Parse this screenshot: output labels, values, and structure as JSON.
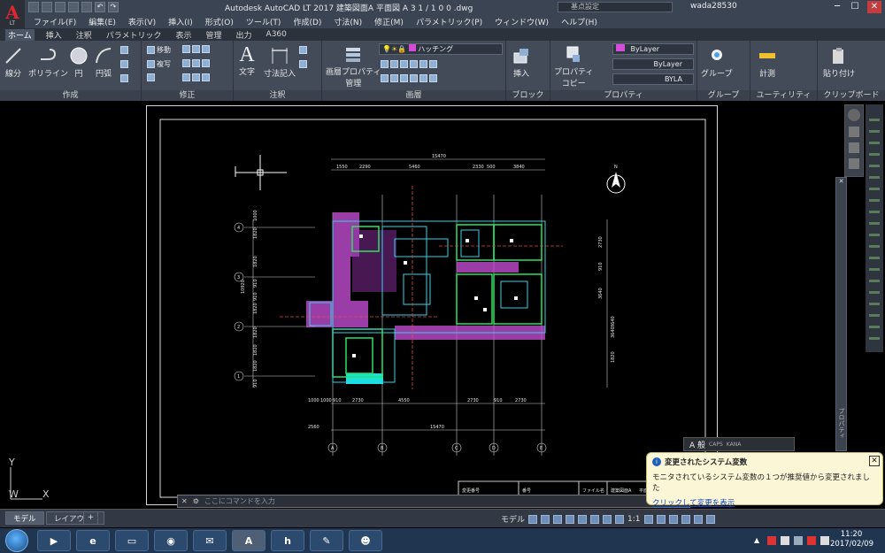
{
  "app": {
    "logo_text": "A",
    "logo_sub": "LT",
    "title": "Autodesk AutoCAD LT 2017    建築図面A    平面図    A 3    1 / 1 0 0 .dwg",
    "search_placeholder": "基点設定",
    "user": "wada28530"
  },
  "menu": [
    "ファイル(F)",
    "編集(E)",
    "表示(V)",
    "挿入(I)",
    "形式(O)",
    "ツール(T)",
    "作成(D)",
    "寸法(N)",
    "修正(M)",
    "パラメトリック(P)",
    "ウィンドウ(W)",
    "ヘルプ(H)"
  ],
  "ribbon_tabs": [
    "ホーム",
    "挿入",
    "注釈",
    "パラメトリック",
    "表示",
    "管理",
    "出力",
    "A360"
  ],
  "ribbon": {
    "draw": {
      "title": "作成",
      "line": "線分",
      "polyline": "ポリライン",
      "circle": "円",
      "arc": "円弧"
    },
    "modify": {
      "title": "修正",
      "move": "移動",
      "copy": "複写"
    },
    "annotation": {
      "title": "注釈",
      "text": "文字",
      "dimension": "寸法記入"
    },
    "layers": {
      "title": "画層",
      "props": "画層プロパティ",
      "props2": "管理",
      "current": "ハッチング"
    },
    "block": {
      "title": "ブロック",
      "insert": "挿入"
    },
    "properties": {
      "title": "プロパティ",
      "copy": "プロパティ",
      "copy2": "コピー",
      "color": "ByLayer",
      "linetype": "ByLayer",
      "lineweight": "BYLA"
    },
    "groups": {
      "title": "グループ",
      "group": "グループ"
    },
    "utilities": {
      "title": "ユーティリティ",
      "measure": "計測"
    },
    "clipboard": {
      "title": "クリップボード",
      "paste": "貼り付け"
    }
  },
  "drawing": {
    "top_dims": [
      "15470",
      "1550",
      "2290",
      "5460",
      "2330",
      "500",
      "3840"
    ],
    "bottom_dims": [
      "1000",
      "1000",
      "910",
      "2730",
      "4550",
      "2730",
      "910",
      "2730",
      "15470",
      "2560"
    ],
    "grid_cols": [
      "A",
      "B",
      "C",
      "D",
      "E"
    ],
    "grid_rows": [
      "4",
      "3",
      "2",
      "1"
    ],
    "left_dims": [
      "1000",
      "1820",
      "1820",
      "910",
      "910",
      "1820",
      "10920",
      "1820",
      "1820",
      "1820",
      "910"
    ],
    "right_dims": [
      "2730",
      "910",
      "3640",
      "3640",
      "1820",
      "3640"
    ],
    "title_block": [
      "変更番号",
      "番号",
      "ファイル名",
      "建築図面A",
      "平面図"
    ],
    "north": "N"
  },
  "command": {
    "placeholder": "ここにコマンドを入力"
  },
  "notification": {
    "title": "変更されたシステム変数",
    "message": "モニタされているシステム変数の１つが推奨値から変更されました",
    "link": "クリックして変更を表示"
  },
  "floatbar": {
    "label": "A 般",
    "caps": "CAPS",
    "kana": "KANA"
  },
  "palette_label": "プロパティ",
  "layout_tabs": [
    "モデル",
    "レイアウト1"
  ],
  "status": {
    "model": "モデル",
    "scale": "1:1"
  },
  "axes": {
    "x": "X",
    "y": "Y",
    "w": "W"
  },
  "taskbar": {
    "apps": [
      "media-player",
      "internet-explorer",
      "file-explorer",
      "chrome",
      "thunderbird",
      "autocad",
      "hpb",
      "paint",
      "game"
    ],
    "time": "11:20",
    "date": "2017/02/09"
  }
}
